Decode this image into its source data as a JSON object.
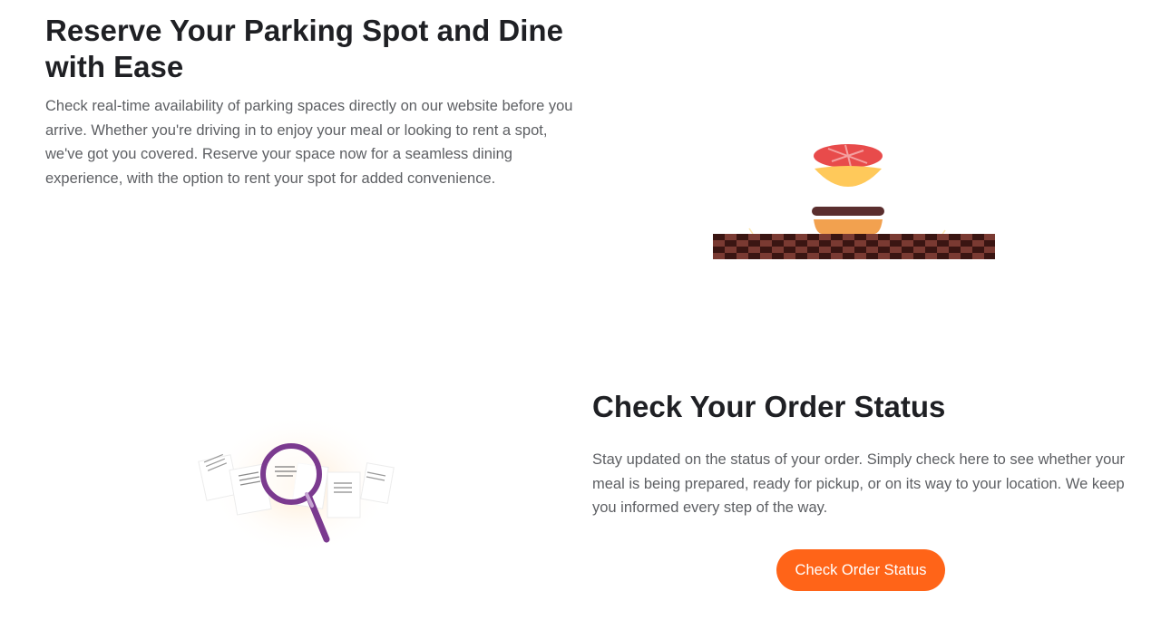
{
  "parking": {
    "title": "Reserve Your Parking Spot and Dine with Ease",
    "description": "Check real-time availability of parking spaces directly on our website before you arrive. Whether you're driving in to enjoy your meal or looking to rent a spot, we've got you covered. Reserve your space now for a seamless dining experience, with the option to rent your spot for added convenience.",
    "illustration_icon": "burger-assembly-illustration"
  },
  "order": {
    "title": "Check Your Order Status",
    "description": "Stay updated on the status of your order. Simply check here to see whether your meal is being prepared, ready for pickup, or on its way to your location. We keep you informed every step of the way.",
    "button_label": "Check Order Status",
    "illustration_icon": "magnifying-glass-documents-illustration"
  },
  "colors": {
    "accent": "#ff6418",
    "heading": "#1f2024",
    "body_text": "#5d5f63",
    "magnifier": "#7b3a8f",
    "tomato": "#e84b4b",
    "cheese": "#ffc95a",
    "patty": "#5a2e2e",
    "checker_dark": "#3a1512",
    "checker_light": "#7a3a32"
  }
}
